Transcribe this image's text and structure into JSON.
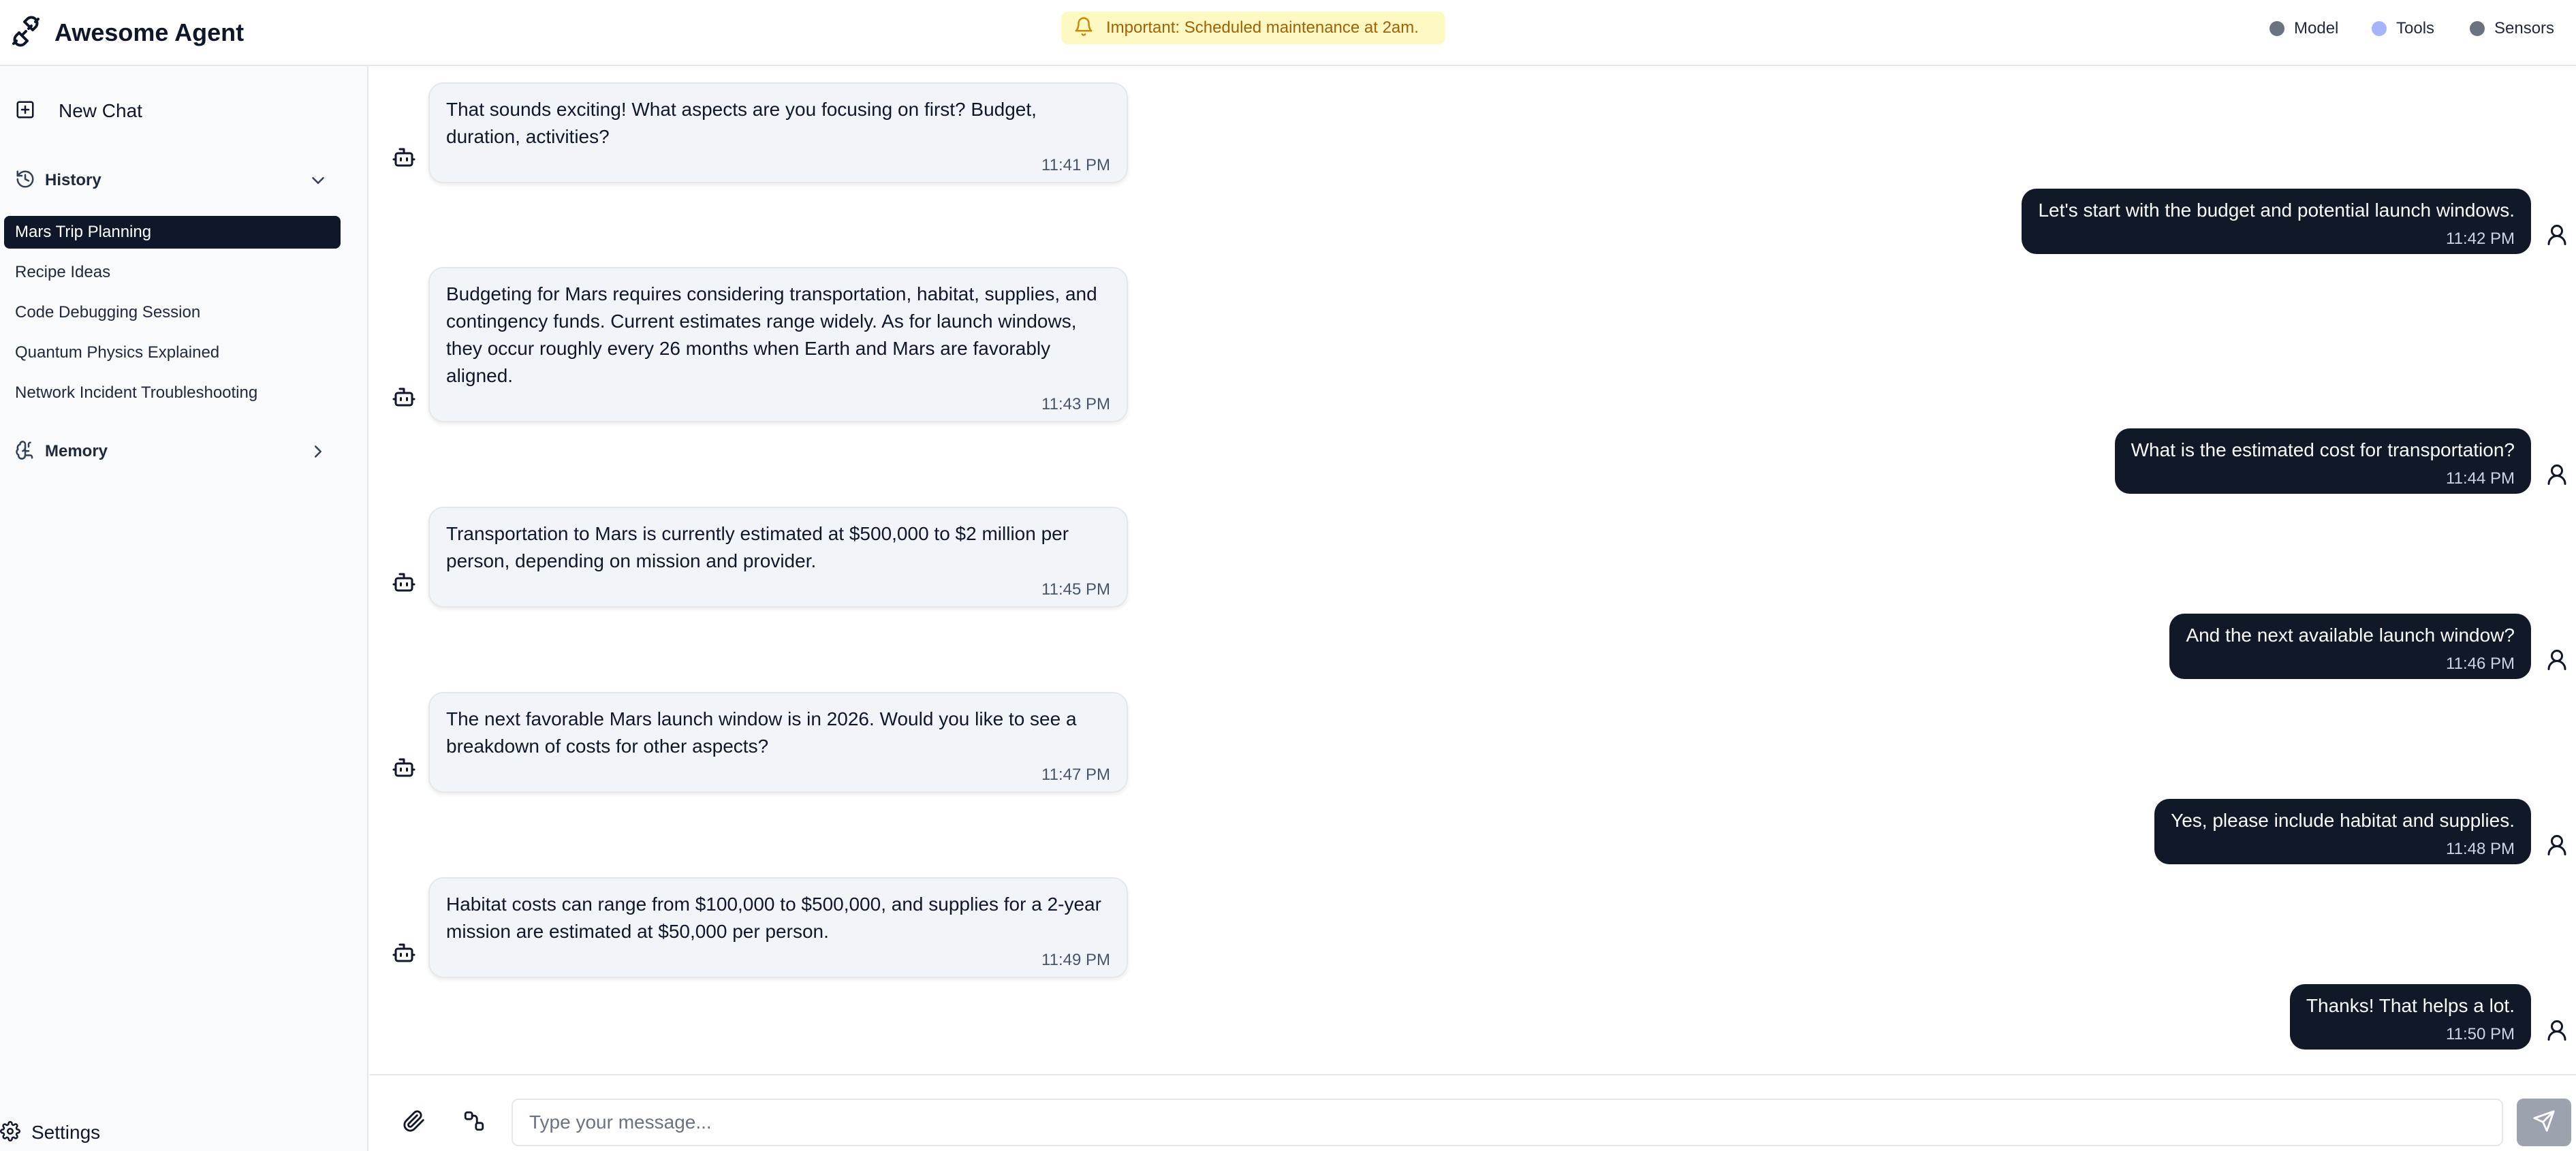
{
  "app": {
    "title": "Awesome Agent",
    "banner": "Important: Scheduled maintenance at 2am.",
    "status": [
      {
        "label": "Model",
        "color": "#6b7280"
      },
      {
        "label": "Tools",
        "color": "#a5b4fc"
      },
      {
        "label": "Sensors",
        "color": "#6b7280"
      }
    ]
  },
  "sidebar": {
    "new_chat": "New Chat",
    "history_label": "History",
    "history_items": [
      {
        "label": "Mars Trip Planning",
        "active": true
      },
      {
        "label": "Recipe Ideas",
        "active": false
      },
      {
        "label": "Code Debugging Session",
        "active": false
      },
      {
        "label": "Quantum Physics Explained",
        "active": false
      },
      {
        "label": "Network Incident Troubleshooting",
        "active": false
      }
    ],
    "memory_label": "Memory",
    "settings_label": "Settings"
  },
  "messages": [
    {
      "role": "assistant",
      "text": "That sounds exciting! What aspects are you focusing on first? Budget, duration, activities?",
      "time": "11:41 PM"
    },
    {
      "role": "user",
      "text": "Let's start with the budget and potential launch windows.",
      "time": "11:42 PM"
    },
    {
      "role": "assistant",
      "text": "Budgeting for Mars requires considering transportation, habitat, supplies, and contingency funds. Current estimates range widely. As for launch windows, they occur roughly every 26 months when Earth and Mars are favorably aligned.",
      "time": "11:43 PM"
    },
    {
      "role": "user",
      "text": "What is the estimated cost for transportation?",
      "time": "11:44 PM"
    },
    {
      "role": "assistant",
      "text": "Transportation to Mars is currently estimated at $500,000 to $2 million per person, depending on mission and provider.",
      "time": "11:45 PM"
    },
    {
      "role": "user",
      "text": "And the next available launch window?",
      "time": "11:46 PM"
    },
    {
      "role": "assistant",
      "text": "The next favorable Mars launch window is in 2026. Would you like to see a breakdown of costs for other aspects?",
      "time": "11:47 PM"
    },
    {
      "role": "user",
      "text": "Yes, please include habitat and supplies.",
      "time": "11:48 PM"
    },
    {
      "role": "assistant",
      "text": "Habitat costs can range from $100,000 to $500,000, and supplies for a 2-year mission are estimated at $50,000 per person.",
      "time": "11:49 PM"
    },
    {
      "role": "user",
      "text": "Thanks! That helps a lot.",
      "time": "11:50 PM"
    }
  ],
  "composer": {
    "placeholder": "Type your message..."
  }
}
